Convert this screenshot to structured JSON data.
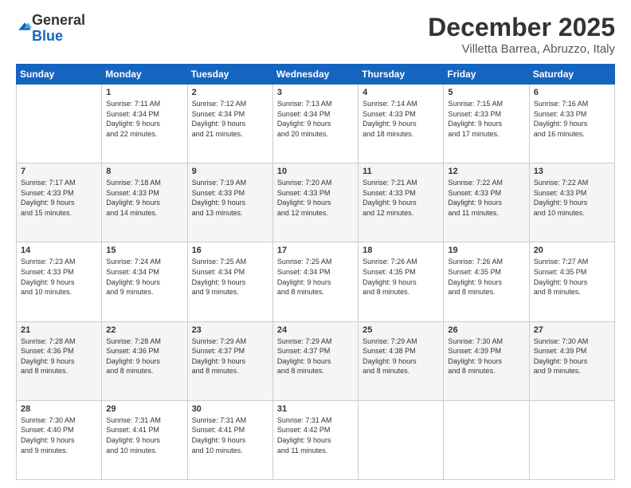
{
  "logo": {
    "general": "General",
    "blue": "Blue"
  },
  "header": {
    "title": "December 2025",
    "subtitle": "Villetta Barrea, Abruzzo, Italy"
  },
  "weekdays": [
    "Sunday",
    "Monday",
    "Tuesday",
    "Wednesday",
    "Thursday",
    "Friday",
    "Saturday"
  ],
  "weeks": [
    [
      {
        "day": "",
        "info": ""
      },
      {
        "day": "1",
        "info": "Sunrise: 7:11 AM\nSunset: 4:34 PM\nDaylight: 9 hours\nand 22 minutes."
      },
      {
        "day": "2",
        "info": "Sunrise: 7:12 AM\nSunset: 4:34 PM\nDaylight: 9 hours\nand 21 minutes."
      },
      {
        "day": "3",
        "info": "Sunrise: 7:13 AM\nSunset: 4:34 PM\nDaylight: 9 hours\nand 20 minutes."
      },
      {
        "day": "4",
        "info": "Sunrise: 7:14 AM\nSunset: 4:33 PM\nDaylight: 9 hours\nand 18 minutes."
      },
      {
        "day": "5",
        "info": "Sunrise: 7:15 AM\nSunset: 4:33 PM\nDaylight: 9 hours\nand 17 minutes."
      },
      {
        "day": "6",
        "info": "Sunrise: 7:16 AM\nSunset: 4:33 PM\nDaylight: 9 hours\nand 16 minutes."
      }
    ],
    [
      {
        "day": "7",
        "info": "Sunrise: 7:17 AM\nSunset: 4:33 PM\nDaylight: 9 hours\nand 15 minutes."
      },
      {
        "day": "8",
        "info": "Sunrise: 7:18 AM\nSunset: 4:33 PM\nDaylight: 9 hours\nand 14 minutes."
      },
      {
        "day": "9",
        "info": "Sunrise: 7:19 AM\nSunset: 4:33 PM\nDaylight: 9 hours\nand 13 minutes."
      },
      {
        "day": "10",
        "info": "Sunrise: 7:20 AM\nSunset: 4:33 PM\nDaylight: 9 hours\nand 12 minutes."
      },
      {
        "day": "11",
        "info": "Sunrise: 7:21 AM\nSunset: 4:33 PM\nDaylight: 9 hours\nand 12 minutes."
      },
      {
        "day": "12",
        "info": "Sunrise: 7:22 AM\nSunset: 4:33 PM\nDaylight: 9 hours\nand 11 minutes."
      },
      {
        "day": "13",
        "info": "Sunrise: 7:22 AM\nSunset: 4:33 PM\nDaylight: 9 hours\nand 10 minutes."
      }
    ],
    [
      {
        "day": "14",
        "info": "Sunrise: 7:23 AM\nSunset: 4:33 PM\nDaylight: 9 hours\nand 10 minutes."
      },
      {
        "day": "15",
        "info": "Sunrise: 7:24 AM\nSunset: 4:34 PM\nDaylight: 9 hours\nand 9 minutes."
      },
      {
        "day": "16",
        "info": "Sunrise: 7:25 AM\nSunset: 4:34 PM\nDaylight: 9 hours\nand 9 minutes."
      },
      {
        "day": "17",
        "info": "Sunrise: 7:25 AM\nSunset: 4:34 PM\nDaylight: 9 hours\nand 8 minutes."
      },
      {
        "day": "18",
        "info": "Sunrise: 7:26 AM\nSunset: 4:35 PM\nDaylight: 9 hours\nand 8 minutes."
      },
      {
        "day": "19",
        "info": "Sunrise: 7:26 AM\nSunset: 4:35 PM\nDaylight: 9 hours\nand 8 minutes."
      },
      {
        "day": "20",
        "info": "Sunrise: 7:27 AM\nSunset: 4:35 PM\nDaylight: 9 hours\nand 8 minutes."
      }
    ],
    [
      {
        "day": "21",
        "info": "Sunrise: 7:28 AM\nSunset: 4:36 PM\nDaylight: 9 hours\nand 8 minutes."
      },
      {
        "day": "22",
        "info": "Sunrise: 7:28 AM\nSunset: 4:36 PM\nDaylight: 9 hours\nand 8 minutes."
      },
      {
        "day": "23",
        "info": "Sunrise: 7:29 AM\nSunset: 4:37 PM\nDaylight: 9 hours\nand 8 minutes."
      },
      {
        "day": "24",
        "info": "Sunrise: 7:29 AM\nSunset: 4:37 PM\nDaylight: 9 hours\nand 8 minutes."
      },
      {
        "day": "25",
        "info": "Sunrise: 7:29 AM\nSunset: 4:38 PM\nDaylight: 9 hours\nand 8 minutes."
      },
      {
        "day": "26",
        "info": "Sunrise: 7:30 AM\nSunset: 4:39 PM\nDaylight: 9 hours\nand 8 minutes."
      },
      {
        "day": "27",
        "info": "Sunrise: 7:30 AM\nSunset: 4:39 PM\nDaylight: 9 hours\nand 9 minutes."
      }
    ],
    [
      {
        "day": "28",
        "info": "Sunrise: 7:30 AM\nSunset: 4:40 PM\nDaylight: 9 hours\nand 9 minutes."
      },
      {
        "day": "29",
        "info": "Sunrise: 7:31 AM\nSunset: 4:41 PM\nDaylight: 9 hours\nand 10 minutes."
      },
      {
        "day": "30",
        "info": "Sunrise: 7:31 AM\nSunset: 4:41 PM\nDaylight: 9 hours\nand 10 minutes."
      },
      {
        "day": "31",
        "info": "Sunrise: 7:31 AM\nSunset: 4:42 PM\nDaylight: 9 hours\nand 11 minutes."
      },
      {
        "day": "",
        "info": ""
      },
      {
        "day": "",
        "info": ""
      },
      {
        "day": "",
        "info": ""
      }
    ]
  ]
}
